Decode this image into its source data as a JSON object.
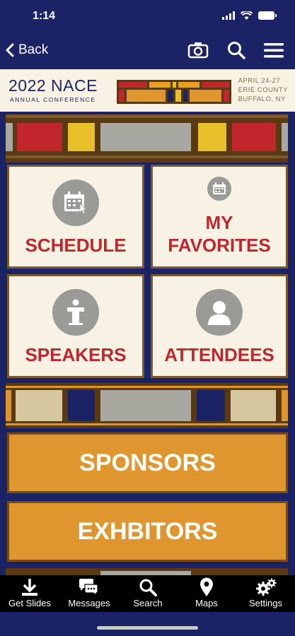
{
  "status_bar": {
    "time": "1:14"
  },
  "nav": {
    "back_label": "Back",
    "icons": [
      "camera-icon",
      "search-icon",
      "menu-icon"
    ]
  },
  "banner": {
    "title": "2022 NACE",
    "subtitle": "ANNUAL CONFERENCE",
    "date": "APRIL 24-27",
    "location_line1": "ERIE COUNTY",
    "location_line2": "BUFFALO, NY"
  },
  "tiles": [
    {
      "id": "schedule",
      "label": "SCHEDULE",
      "icon": "calendar-cursor-icon"
    },
    {
      "id": "favorites",
      "label_line1": "MY",
      "label_line2": "FAVORITES",
      "icon": "calendar-icon"
    },
    {
      "id": "speakers",
      "label": "SPEAKERS",
      "icon": "podium-icon"
    },
    {
      "id": "attendees",
      "label": "ATTENDEES",
      "icon": "person-icon"
    }
  ],
  "buttons": {
    "sponsors": "SPONSORS",
    "exhibitors": "EXHBITORS"
  },
  "tabbar": [
    {
      "label": "Get Slides",
      "icon": "download-icon"
    },
    {
      "label": "Messages",
      "icon": "chat-icon"
    },
    {
      "label": "Search",
      "icon": "search-icon"
    },
    {
      "label": "Maps",
      "icon": "map-pin-icon"
    },
    {
      "label": "Settings",
      "icon": "gears-icon"
    }
  ],
  "colors": {
    "navy": "#1b2266",
    "cream": "#f7f2e3",
    "red": "#c0262b",
    "orange": "#e0962e",
    "brown": "#5a3a12",
    "gold": "#e8c02a",
    "gray": "#a8a8a0",
    "tan": "#d8c8a0"
  }
}
